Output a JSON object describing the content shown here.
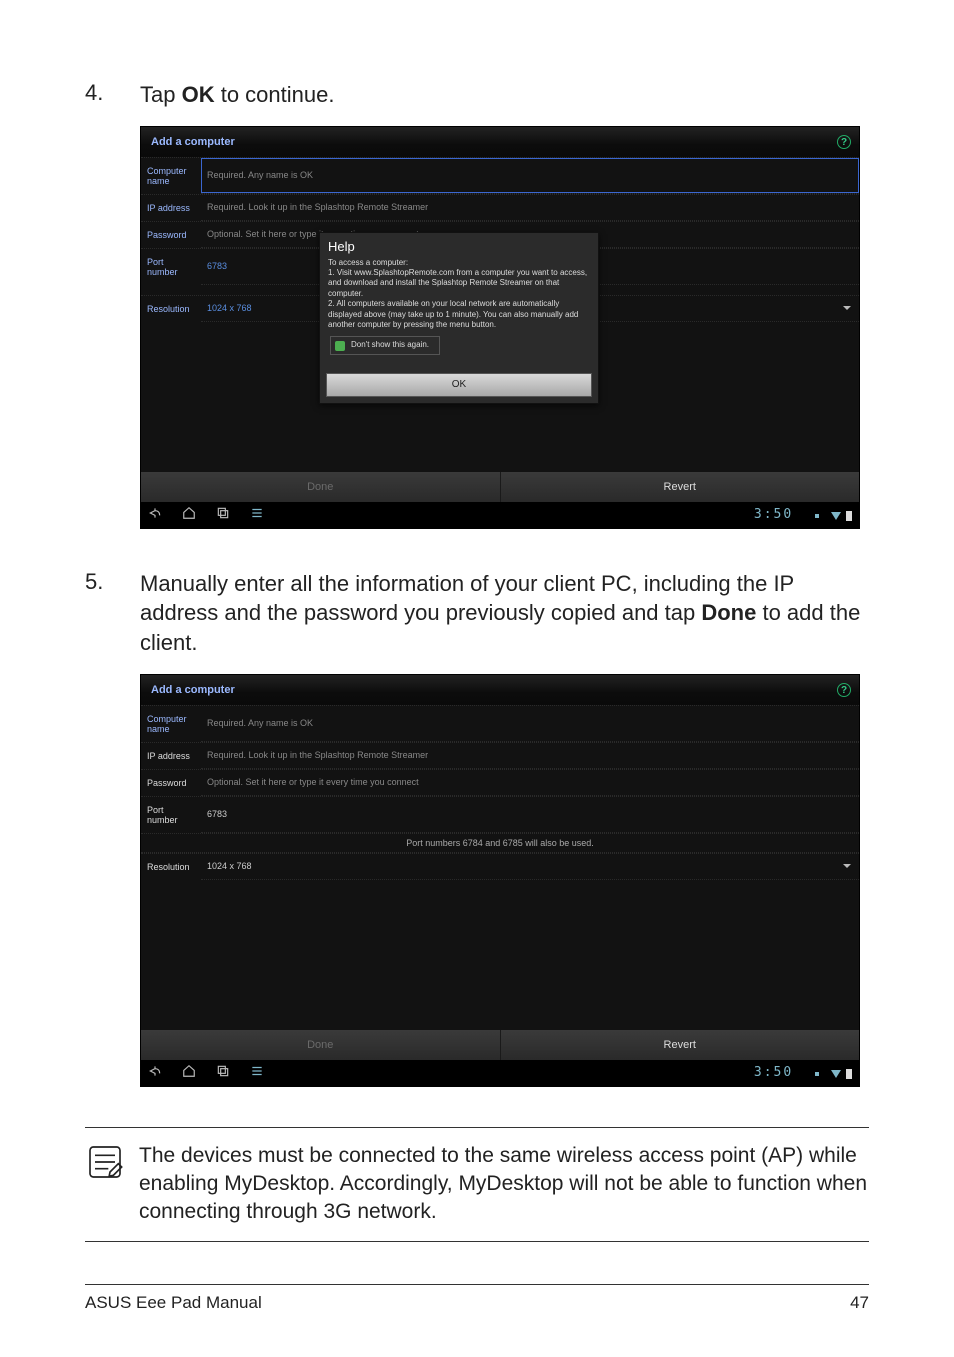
{
  "step4": {
    "num": "4.",
    "pre": "Tap ",
    "bold": "OK",
    "post": " to continue."
  },
  "step5": {
    "num": "5.",
    "pre": "Manually enter all the information of your client PC, including the IP address and the password you previously copied and tap ",
    "bold": "Done",
    "post": " to add the client."
  },
  "shot": {
    "title": "Add a computer",
    "labels": {
      "computer_name": "Computer name",
      "ip_address": "IP address",
      "password": "Password",
      "port_number": "Port number",
      "resolution": "Resolution"
    },
    "placeholders": {
      "computer_name": "Required. Any name is OK",
      "ip_address": "Required. Look it up in the Splashtop Remote Streamer",
      "password": "Optional. Set it here or type it every time you connect",
      "port_number": "6783",
      "resolution": "1024 x 768"
    },
    "port_note": "Port numbers 6784 and 6785 will also be used.",
    "actions": {
      "done": "Done",
      "revert": "Revert"
    }
  },
  "dialog": {
    "title": "Help",
    "line1": "To access a computer:",
    "line2": "1. Visit www.SplashtopRemote.com from a computer you want to access, and download and install the Splashtop Remote Streamer on that computer.",
    "line3": "2. All computers available on your local network are automatically displayed above (may take up to 1 minute). You can also manually add another computer by pressing the menu button.",
    "checkbox": "Don't show this again.",
    "ok": "OK"
  },
  "navbar": {
    "clock": "3:50"
  },
  "note": {
    "text": "The devices must be connected to the same wireless access point (AP) while enabling MyDesktop. Accordingly, MyDesktop will not be able to function when connecting through 3G network."
  },
  "footer": {
    "left": "ASUS Eee Pad Manual",
    "right": "47"
  }
}
